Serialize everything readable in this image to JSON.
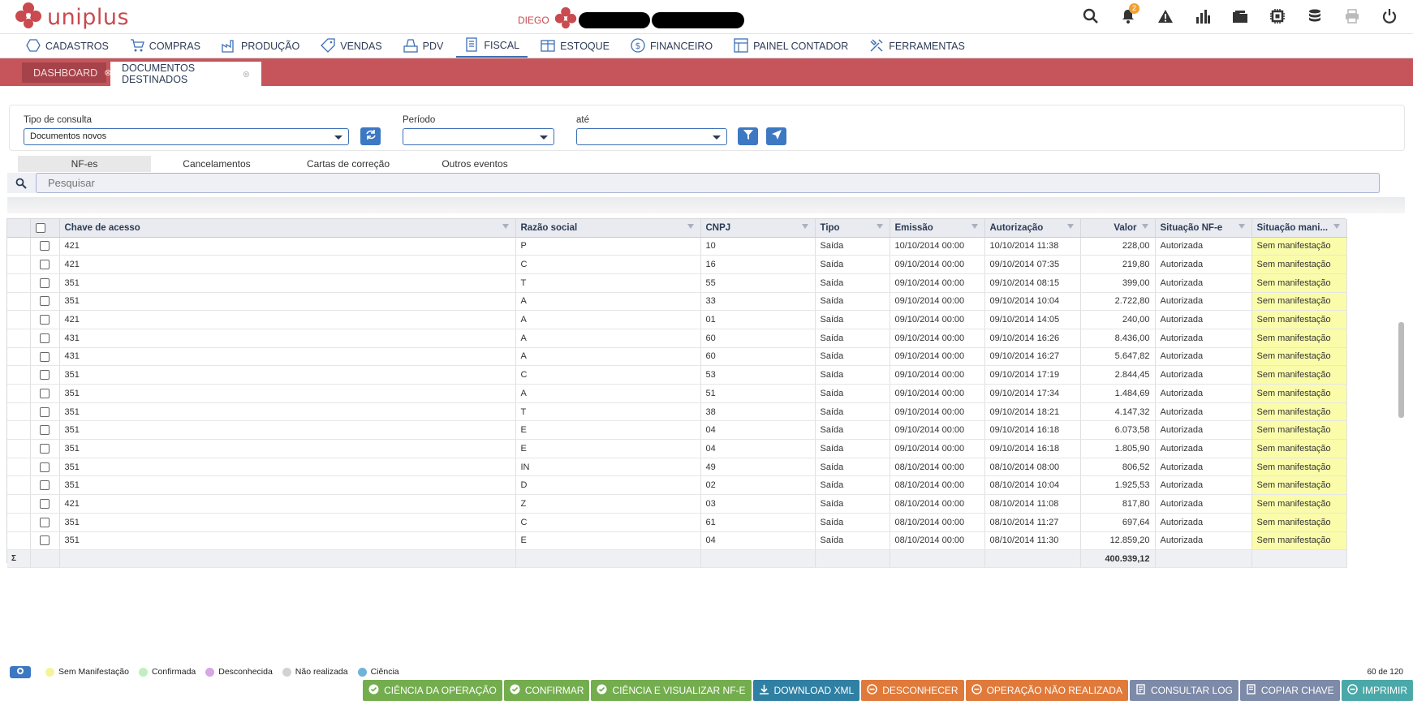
{
  "app": {
    "brand": "uniplus",
    "user_name": "DIEGO",
    "notifications_count": "2",
    "brand_color": "#c94a4f"
  },
  "menu": [
    {
      "label": "CADASTROS",
      "icon": "hexagon-icon"
    },
    {
      "label": "COMPRAS",
      "icon": "cart-icon"
    },
    {
      "label": "PRODUÇÃO",
      "icon": "factory-icon"
    },
    {
      "label": "VENDAS",
      "icon": "tag-icon"
    },
    {
      "label": "PDV",
      "icon": "register-icon"
    },
    {
      "label": "FISCAL",
      "icon": "document-icon",
      "active": true
    },
    {
      "label": "ESTOQUE",
      "icon": "box-icon"
    },
    {
      "label": "FINANCEIRO",
      "icon": "dollar-icon"
    },
    {
      "label": "PAINEL CONTADOR",
      "icon": "panel-icon"
    },
    {
      "label": "FERRAMENTAS",
      "icon": "tools-icon"
    }
  ],
  "tabs": [
    {
      "label": "DASHBOARD"
    },
    {
      "label": "DOCUMENTOS DESTINADOS"
    }
  ],
  "filter": {
    "tipo_label": "Tipo de consulta",
    "tipo_value": "Documentos novos",
    "periodo_label": "Período",
    "periodo_value": "",
    "ate_label": "até",
    "ate_value": ""
  },
  "subtabs": [
    "NF-es",
    "Cancelamentos",
    "Cartas de correção",
    "Outros eventos"
  ],
  "search": {
    "placeholder": "Pesquisar"
  },
  "grid": {
    "columns": [
      "Chave de acesso",
      "Razão social",
      "CNPJ",
      "Tipo",
      "Emissão",
      "Autorização",
      "Valor",
      "Situação NF-e",
      "Situação mani..."
    ],
    "rows": [
      [
        "421",
        "P",
        "10",
        "Saída",
        "10/10/2014 00:00",
        "10/10/2014 11:38",
        "228,00",
        "Autorizada",
        "Sem manifestação"
      ],
      [
        "421",
        "C",
        "16",
        "Saída",
        "09/10/2014 00:00",
        "09/10/2014 07:35",
        "219,80",
        "Autorizada",
        "Sem manifestação"
      ],
      [
        "351",
        "T",
        "55",
        "Saída",
        "09/10/2014 00:00",
        "09/10/2014 08:15",
        "399,00",
        "Autorizada",
        "Sem manifestação"
      ],
      [
        "351",
        "A",
        "33",
        "Saída",
        "09/10/2014 00:00",
        "09/10/2014 10:04",
        "2.722,80",
        "Autorizada",
        "Sem manifestação"
      ],
      [
        "421",
        "A",
        "01",
        "Saída",
        "09/10/2014 00:00",
        "09/10/2014 14:05",
        "240,00",
        "Autorizada",
        "Sem manifestação"
      ],
      [
        "431",
        "A",
        "60",
        "Saída",
        "09/10/2014 00:00",
        "09/10/2014 16:26",
        "8.436,00",
        "Autorizada",
        "Sem manifestação"
      ],
      [
        "431",
        "A",
        "60",
        "Saída",
        "09/10/2014 00:00",
        "09/10/2014 16:27",
        "5.647,82",
        "Autorizada",
        "Sem manifestação"
      ],
      [
        "351",
        "C",
        "53",
        "Saída",
        "09/10/2014 00:00",
        "09/10/2014 17:19",
        "2.844,45",
        "Autorizada",
        "Sem manifestação"
      ],
      [
        "351",
        "A",
        "51",
        "Saída",
        "09/10/2014 00:00",
        "09/10/2014 17:34",
        "1.484,69",
        "Autorizada",
        "Sem manifestação"
      ],
      [
        "351",
        "T",
        "38",
        "Saída",
        "09/10/2014 00:00",
        "09/10/2014 18:21",
        "4.147,32",
        "Autorizada",
        "Sem manifestação"
      ],
      [
        "351",
        "E",
        "04",
        "Saída",
        "09/10/2014 00:00",
        "09/10/2014 16:18",
        "6.073,58",
        "Autorizada",
        "Sem manifestação"
      ],
      [
        "351",
        "E",
        "04",
        "Saída",
        "09/10/2014 00:00",
        "09/10/2014 16:18",
        "1.805,90",
        "Autorizada",
        "Sem manifestação"
      ],
      [
        "351",
        "IN",
        "49",
        "Saída",
        "08/10/2014 00:00",
        "08/10/2014 08:00",
        "806,52",
        "Autorizada",
        "Sem manifestação"
      ],
      [
        "351",
        "D",
        "02",
        "Saída",
        "08/10/2014 00:00",
        "08/10/2014 10:04",
        "1.925,53",
        "Autorizada",
        "Sem manifestação"
      ],
      [
        "421",
        "Z",
        "03",
        "Saída",
        "08/10/2014 00:00",
        "08/10/2014 11:08",
        "817,80",
        "Autorizada",
        "Sem manifestação"
      ],
      [
        "351",
        "C",
        "61",
        "Saída",
        "08/10/2014 00:00",
        "08/10/2014 11:27",
        "697,64",
        "Autorizada",
        "Sem manifestação"
      ],
      [
        "351",
        "E",
        "04",
        "Saída",
        "08/10/2014 00:00",
        "08/10/2014 11:30",
        "12.859,20",
        "Autorizada",
        "Sem manifestação"
      ]
    ],
    "total_symbol": "Σ",
    "total_value": "400.939,12"
  },
  "legend": [
    {
      "label": "Sem Manifestação",
      "color": "#f6f49a"
    },
    {
      "label": "Confirmada",
      "color": "#bff0bf"
    },
    {
      "label": "Desconhecida",
      "color": "#d6a6e6"
    },
    {
      "label": "Não realizada",
      "color": "#d2d2d2"
    },
    {
      "label": "Ciência",
      "color": "#6fb3d9"
    }
  ],
  "pager": "60 de 120",
  "actions": [
    {
      "label": "CIÊNCIA DA OPERAÇÃO",
      "color": "#74ad4e",
      "icon": "check-circle-icon"
    },
    {
      "label": "CONFIRMAR",
      "color": "#74ad4e",
      "icon": "check-circle-icon"
    },
    {
      "label": "CIÊNCIA E VISUALIZAR NF-E",
      "color": "#74ad4e",
      "icon": "check-circle-icon"
    },
    {
      "label": "DOWNLOAD XML",
      "color": "#2f80a3",
      "icon": "download-icon"
    },
    {
      "label": "DESCONHECER",
      "color": "#e07a3a",
      "icon": "minus-circle-icon"
    },
    {
      "label": "OPERAÇÃO NÃO REALIZADA",
      "color": "#e07a3a",
      "icon": "minus-circle-icon"
    },
    {
      "label": "CONSULTAR LOG",
      "color": "#7d8aa8",
      "icon": "log-icon"
    },
    {
      "label": "COPIAR CHAVE",
      "color": "#7d8aa8",
      "icon": "copy-icon"
    },
    {
      "label": "IMPRIMIR",
      "color": "#4aa8a8",
      "icon": "minus-circle-icon"
    }
  ]
}
